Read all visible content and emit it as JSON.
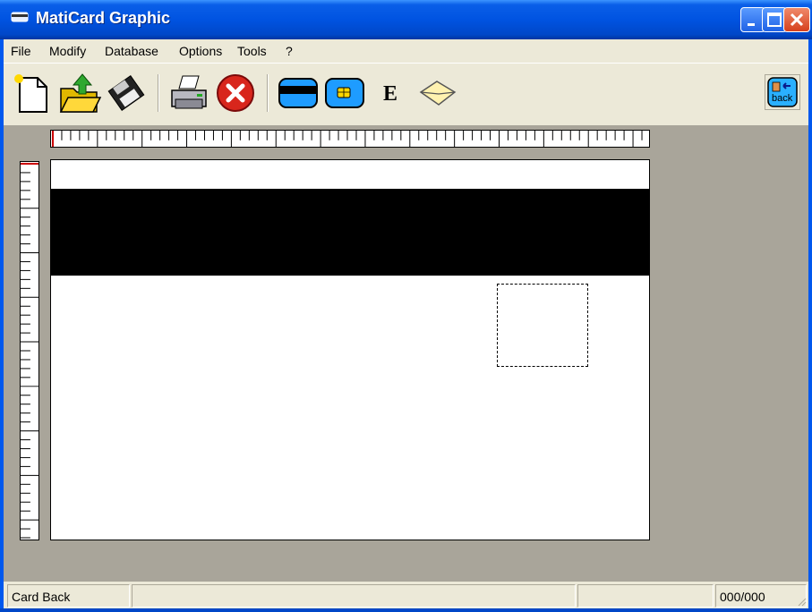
{
  "window": {
    "title": "MatiCard Graphic",
    "titlebar_color": "#0053e1"
  },
  "menu": {
    "items": [
      {
        "label": "File"
      },
      {
        "label": "Modify"
      },
      {
        "label": "Database"
      },
      {
        "label": "Options"
      },
      {
        "label": "Tools"
      },
      {
        "label": "?"
      }
    ]
  },
  "toolbar": {
    "buttons": [
      {
        "icon": "new-document-icon"
      },
      {
        "icon": "open-folder-icon"
      },
      {
        "icon": "save-disk-icon"
      },
      {
        "icon": "print-icon"
      },
      {
        "icon": "close-red-icon"
      },
      {
        "icon": "card-magstripe-icon"
      },
      {
        "icon": "chip-card-icon"
      },
      {
        "icon": "encode-e-icon"
      },
      {
        "icon": "envelope-icon"
      },
      {
        "icon": "card-back-icon"
      }
    ],
    "back_label": "back"
  },
  "status": {
    "mode": "Card Back",
    "counter": "000/000"
  }
}
